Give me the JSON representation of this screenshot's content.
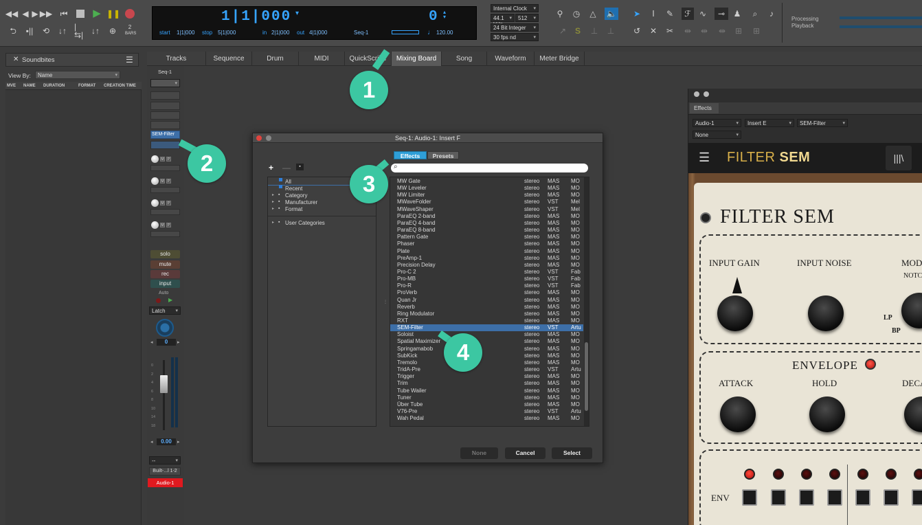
{
  "toolbar": {
    "bars_label": "BARS",
    "bars_value": "2",
    "counter": {
      "main": "1|1|000",
      "aux": "0",
      "start_label": "start",
      "start_value": "1|1|000",
      "stop_label": "stop",
      "stop_value": "5|1|000",
      "in_label": "in",
      "in_value": "2|1|000",
      "out_label": "out",
      "out_value": "4|1|000",
      "seq": "Seq-1",
      "tempo": "120.00"
    },
    "clock": "Internal Clock",
    "sample_rate": "44.1 kHz",
    "buffer": "512",
    "bit_depth": "24 Bit Integer",
    "fps": "30 fps nd",
    "status_line1": "Processing",
    "status_line2": "Playback",
    "accent": "#36a4ff"
  },
  "tabs": [
    {
      "label": "Tracks"
    },
    {
      "label": "Sequence"
    },
    {
      "label": "Drum"
    },
    {
      "label": "MIDI"
    },
    {
      "label": "QuickScribe"
    },
    {
      "label": "Mixing Board"
    },
    {
      "label": "Song"
    },
    {
      "label": "Waveform"
    },
    {
      "label": "Meter Bridge"
    }
  ],
  "soundbites": {
    "title": "Soundbites",
    "view_by_label": "View By:",
    "view_by_value": "Name",
    "columns": [
      "MVE",
      "NAME",
      "DURATION",
      "FORMAT",
      "CREATION TIME"
    ]
  },
  "strip": {
    "seq_label": "Seq-1",
    "insert": "SEM-Filter",
    "solo": "solo",
    "mute": "mute",
    "rec": "rec",
    "input": "input",
    "auto": "Auto",
    "latch": "Latch",
    "pan_value": "0",
    "fader_value": "0.00",
    "output": "Built-...l 1-2",
    "track_name": "Audio-1",
    "fader_scale": [
      "0",
      "2",
      "4",
      "6",
      "8",
      "10",
      "14",
      "18"
    ]
  },
  "dialog": {
    "title": "Seq-1: Audio-1: Insert F",
    "tab_effects": "Effects",
    "tab_presets": "Presets",
    "categories": [
      "All",
      "Recent",
      "Category",
      "Manufacturer",
      "Format",
      "User Categories"
    ],
    "plugins": [
      {
        "name": "MW Gate",
        "ch": "stereo",
        "fmt": "MAS",
        "mfr": "MO"
      },
      {
        "name": "MW Leveler",
        "ch": "stereo",
        "fmt": "MAS",
        "mfr": "MO"
      },
      {
        "name": "MW Limiter",
        "ch": "stereo",
        "fmt": "MAS",
        "mfr": "MO"
      },
      {
        "name": "MWaveFolder",
        "ch": "stereo",
        "fmt": "VST",
        "mfr": "Mel"
      },
      {
        "name": "MWaveShaper",
        "ch": "stereo",
        "fmt": "VST",
        "mfr": "Mel"
      },
      {
        "name": "ParaEQ 2-band",
        "ch": "stereo",
        "fmt": "MAS",
        "mfr": "MO"
      },
      {
        "name": "ParaEQ 4-band",
        "ch": "stereo",
        "fmt": "MAS",
        "mfr": "MO"
      },
      {
        "name": "ParaEQ 8-band",
        "ch": "stereo",
        "fmt": "MAS",
        "mfr": "MO"
      },
      {
        "name": "Pattern Gate",
        "ch": "stereo",
        "fmt": "MAS",
        "mfr": "MO"
      },
      {
        "name": "Phaser",
        "ch": "stereo",
        "fmt": "MAS",
        "mfr": "MO"
      },
      {
        "name": "Plate",
        "ch": "stereo",
        "fmt": "MAS",
        "mfr": "MO"
      },
      {
        "name": "PreAmp-1",
        "ch": "stereo",
        "fmt": "MAS",
        "mfr": "MO"
      },
      {
        "name": "Precision Delay",
        "ch": "stereo",
        "fmt": "MAS",
        "mfr": "MO"
      },
      {
        "name": "Pro-C 2",
        "ch": "stereo",
        "fmt": "VST",
        "mfr": "Fab"
      },
      {
        "name": "Pro-MB",
        "ch": "stereo",
        "fmt": "VST",
        "mfr": "Fab"
      },
      {
        "name": "Pro-R",
        "ch": "stereo",
        "fmt": "VST",
        "mfr": "Fab"
      },
      {
        "name": "ProVerb",
        "ch": "stereo",
        "fmt": "MAS",
        "mfr": "MO"
      },
      {
        "name": "Quan Jr",
        "ch": "stereo",
        "fmt": "MAS",
        "mfr": "MO"
      },
      {
        "name": "Reverb",
        "ch": "stereo",
        "fmt": "MAS",
        "mfr": "MO"
      },
      {
        "name": "Ring Modulator",
        "ch": "stereo",
        "fmt": "MAS",
        "mfr": "MO"
      },
      {
        "name": "RXT",
        "ch": "stereo",
        "fmt": "MAS",
        "mfr": "MO"
      },
      {
        "name": "SEM-Filter",
        "ch": "stereo",
        "fmt": "VST",
        "mfr": "Artu",
        "selected": true
      },
      {
        "name": "Soloist",
        "ch": "stereo",
        "fmt": "MAS",
        "mfr": "MO"
      },
      {
        "name": "Spatial Maximizer",
        "ch": "stereo",
        "fmt": "MAS",
        "mfr": "MO"
      },
      {
        "name": "Springamabob",
        "ch": "stereo",
        "fmt": "MAS",
        "mfr": "MO"
      },
      {
        "name": "SubKick",
        "ch": "stereo",
        "fmt": "MAS",
        "mfr": "MO"
      },
      {
        "name": "Tremolo",
        "ch": "stereo",
        "fmt": "MAS",
        "mfr": "MO"
      },
      {
        "name": "TridA-Pre",
        "ch": "stereo",
        "fmt": "VST",
        "mfr": "Artu"
      },
      {
        "name": "Trigger",
        "ch": "stereo",
        "fmt": "MAS",
        "mfr": "MO"
      },
      {
        "name": "Trim",
        "ch": "stereo",
        "fmt": "MAS",
        "mfr": "MO"
      },
      {
        "name": "Tube Wailer",
        "ch": "stereo",
        "fmt": "MAS",
        "mfr": "MO"
      },
      {
        "name": "Tuner",
        "ch": "stereo",
        "fmt": "MAS",
        "mfr": "MO"
      },
      {
        "name": "Über Tube",
        "ch": "stereo",
        "fmt": "MAS",
        "mfr": "MO"
      },
      {
        "name": "V76-Pre",
        "ch": "stereo",
        "fmt": "VST",
        "mfr": "Artu"
      },
      {
        "name": "Wah Pedal",
        "ch": "stereo",
        "fmt": "MAS",
        "mfr": "MO"
      }
    ],
    "btn_none": "None",
    "btn_cancel": "Cancel",
    "btn_select": "Select"
  },
  "plugin_window": {
    "tab": "Effects",
    "track": "Audio-1",
    "insert": "Insert E",
    "plugin": "SEM-Filter",
    "preset": "None",
    "header_title_a": "FILTER",
    "header_title_b": "SEM",
    "panel_title": "FILTER SEM",
    "input_gain": "INPUT GAIN",
    "input_noise": "INPUT NOISE",
    "mod_partial": "MOD",
    "notch_partial": "NOTC",
    "lp": "LP",
    "bp": "BP",
    "envelope": "ENVELOPE",
    "attack": "ATTACK",
    "hold": "HOLD",
    "decay_partial": "DECA",
    "env": "ENV"
  },
  "annotations": [
    "1",
    "2",
    "3",
    "4"
  ],
  "colors": {
    "annotation": "#3cc7a2",
    "selection": "#3d6fa8",
    "track_red": "#e0191f"
  }
}
